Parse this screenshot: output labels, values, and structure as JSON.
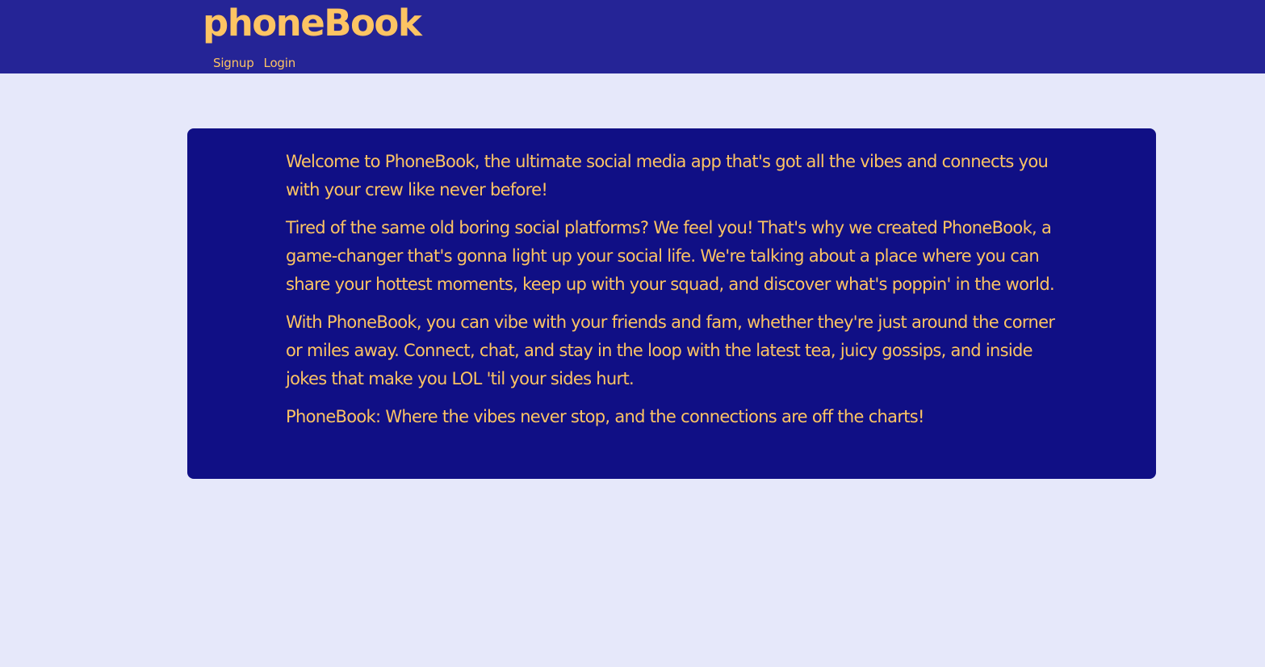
{
  "header": {
    "brand": "phoneBook",
    "nav": {
      "signup_label": "Signup",
      "login_label": "Login"
    }
  },
  "main": {
    "paragraphs": [
      "Welcome to PhoneBook, the ultimate social media app that's got all the vibes and connects you with your crew like never before!",
      "Tired of the same old boring social platforms? We feel you! That's why we created PhoneBook, a game-changer that's gonna light up your social life. We're talking about a place where you can share your hottest moments, keep up with your squad, and discover what's poppin' in the world.",
      "With PhoneBook, you can vibe with your friends and fam, whether they're just around the corner or miles away. Connect, chat, and stay in the loop with the latest tea, juicy gossips, and inside jokes that make you LOL 'til your sides hurt.",
      "PhoneBook: Where the vibes never stop, and the connections are off the charts!"
    ]
  },
  "colors": {
    "header_bg": "#252496",
    "page_bg": "#e6e8fa",
    "card_bg": "#100f85",
    "accent_text": "#fdc463"
  }
}
